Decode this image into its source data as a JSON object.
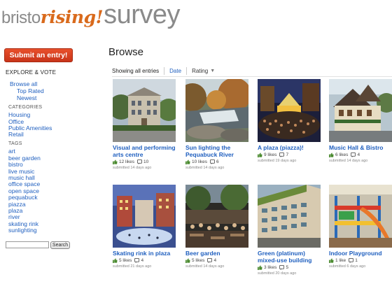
{
  "logo": {
    "part1": "bristo",
    "part2": "rising!",
    "part3": "survey"
  },
  "sidebar": {
    "submit_label": "Submit an entry!",
    "explore_heading": "EXPLORE & VOTE",
    "browse_all": "Browse all",
    "top_rated": "Top Rated",
    "newest": "Newest",
    "categories_heading": "CATEGORIES",
    "categories": [
      "Housing",
      "Office",
      "Public Amenities",
      "Retail"
    ],
    "tags_heading": "TAGS",
    "tags": [
      "art",
      "beer garden",
      "bistro",
      "live music",
      "music hall",
      "office space",
      "open space",
      "pequabuck",
      "piazza",
      "plaza",
      "river",
      "skating rink",
      "sunlighting"
    ],
    "search_placeholder": "",
    "search_button": "Search"
  },
  "main": {
    "title": "Browse",
    "filter_showing": "Showing all entries",
    "filter_date": "Date",
    "filter_rating": "Rating",
    "cards": [
      {
        "title": "Visual and performing arts centre",
        "likes": "12 likes",
        "comments": "10",
        "submitted": "submitted 14 days ago",
        "image": "building"
      },
      {
        "title": "Sun lighting the Pequabuck River",
        "likes": "10 likes",
        "comments": "6",
        "submitted": "submitted 14 days ago",
        "image": "river"
      },
      {
        "title": "A plaza (piazza)!",
        "likes": "9 likes",
        "comments": "7",
        "submitted": "submitted 19 days ago",
        "image": "piazza"
      },
      {
        "title": "Music Hall & Bistro",
        "likes": "6 likes",
        "comments": "4",
        "submitted": "submitted 14 days ago",
        "image": "hall"
      },
      {
        "title": "Skating rink in plaza",
        "likes": "5 likes",
        "comments": "4",
        "submitted": "submitted 21 days ago",
        "image": "rink"
      },
      {
        "title": "Beer garden",
        "likes": "5 likes",
        "comments": "4",
        "submitted": "submitted 14 days ago",
        "image": "beergarden"
      },
      {
        "title": "Green (platinum) mixed-use building",
        "likes": "3 likes",
        "comments": "5",
        "submitted": "submitted 20 days ago",
        "image": "green"
      },
      {
        "title": "Indoor Playground",
        "likes": "1 like",
        "comments": "1",
        "submitted": "submitted 6 days ago",
        "image": "playground"
      }
    ]
  }
}
